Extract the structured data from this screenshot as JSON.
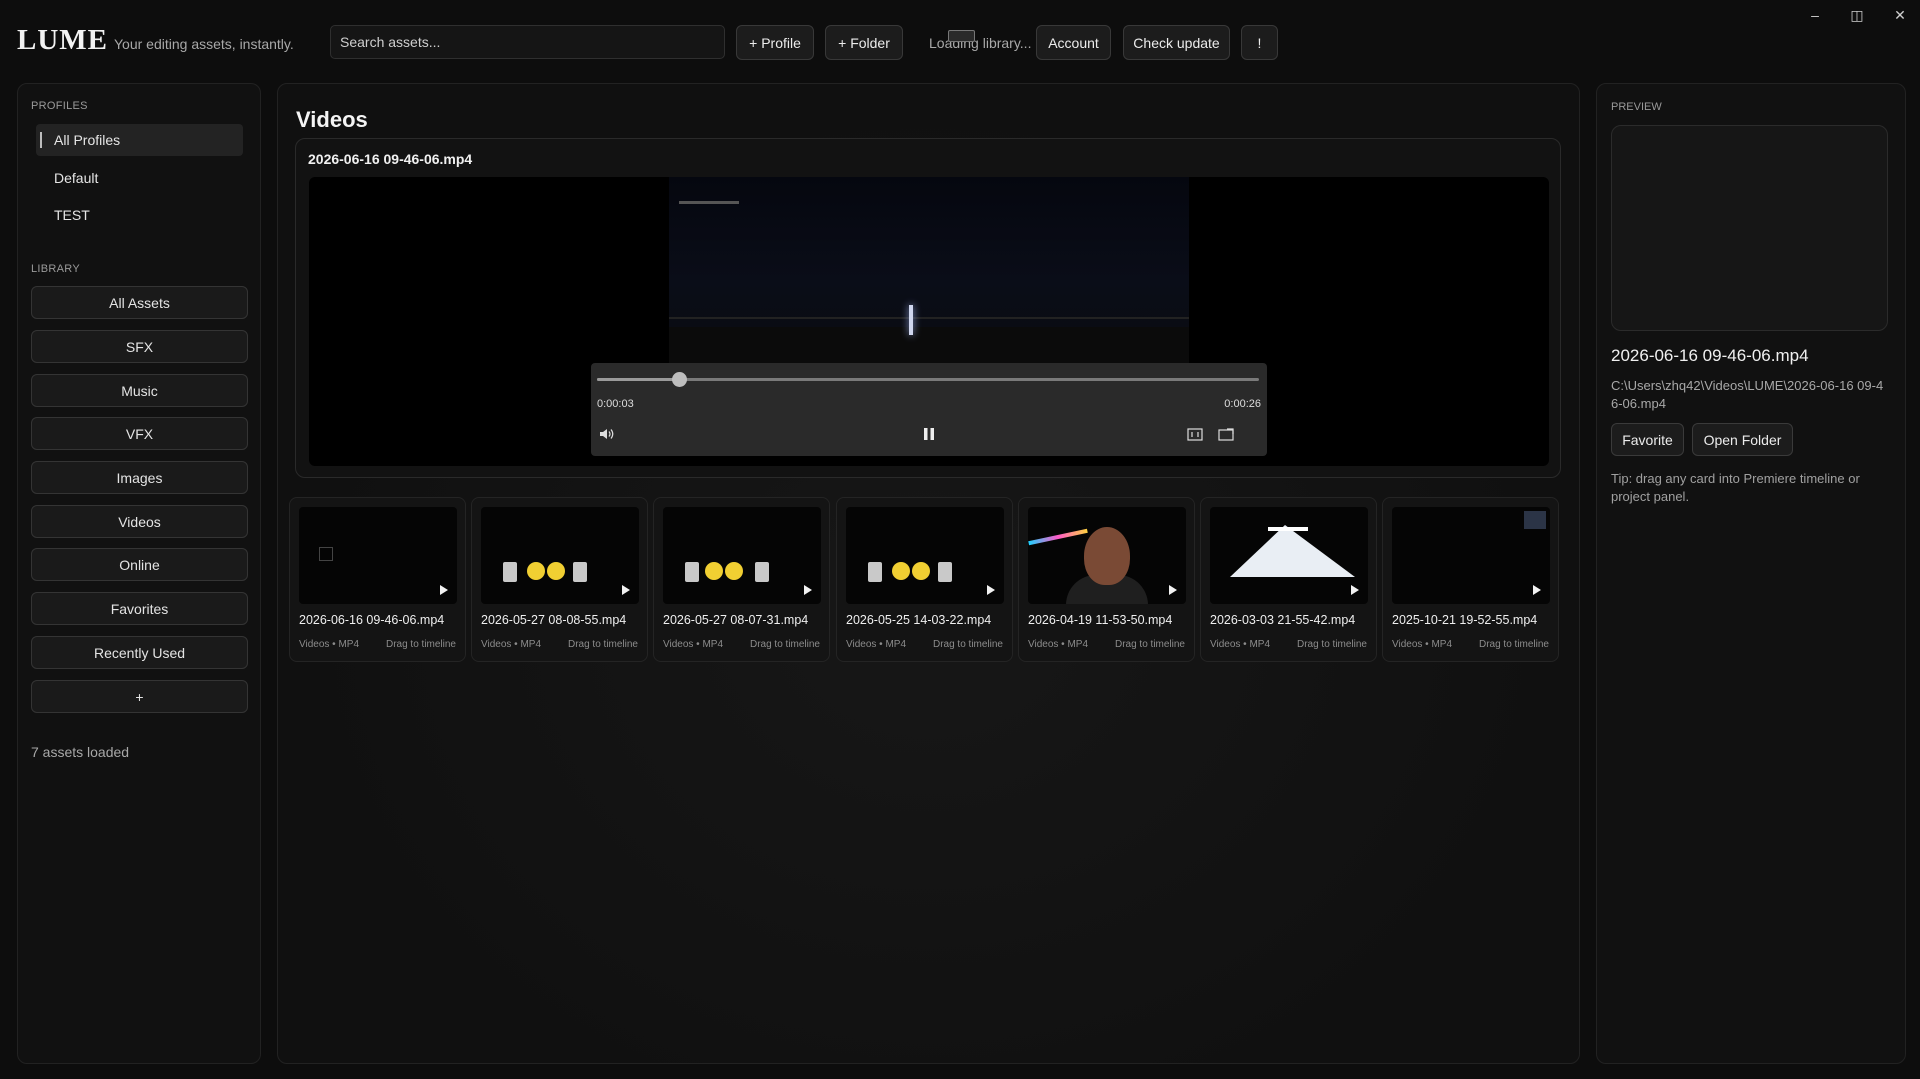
{
  "app": {
    "brand": "LUME",
    "tagline": "Your editing assets, instantly."
  },
  "toolbar": {
    "search_placeholder": "Search assets...",
    "add_profile_label": "+ Profile",
    "add_folder_label": "+ Folder",
    "loading_text": "Loading library...",
    "account_label": "Account",
    "check_update_label": "Check update",
    "alert_label": "!"
  },
  "window_controls": {
    "minimize": "–",
    "maximize": "◫",
    "close": "✕"
  },
  "sidebar": {
    "profiles_heading": "PROFILES",
    "profiles": [
      "All Profiles",
      "Default",
      "TEST"
    ],
    "library_heading": "LIBRARY",
    "library_items": [
      "All Assets",
      "SFX",
      "Music",
      "VFX",
      "Images",
      "Videos",
      "Online",
      "Favorites",
      "Recently Used",
      "+"
    ],
    "assets_count": "7 assets loaded"
  },
  "main": {
    "title": "Videos",
    "player": {
      "file_name": "2026-06-16 09-46-06.mp4",
      "current_time": "0:00:03",
      "duration": "0:00:26",
      "progress": 0.124
    },
    "cards": [
      {
        "name": "2026-06-16 09-46-06.mp4",
        "meta": "Videos • MP4",
        "drag": "Drag to timeline",
        "thumb": "dark"
      },
      {
        "name": "2026-05-27 08-08-55.mp4",
        "meta": "Videos • MP4",
        "drag": "Drag to timeline",
        "thumb": "ui"
      },
      {
        "name": "2026-05-27 08-07-31.mp4",
        "meta": "Videos • MP4",
        "drag": "Drag to timeline",
        "thumb": "ui"
      },
      {
        "name": "2026-05-25 14-03-22.mp4",
        "meta": "Videos • MP4",
        "drag": "Drag to timeline",
        "thumb": "ui"
      },
      {
        "name": "2026-04-19 11-53-50.mp4",
        "meta": "Videos • MP4",
        "drag": "Drag to timeline",
        "thumb": "person"
      },
      {
        "name": "2026-03-03 21-55-42.mp4",
        "meta": "Videos • MP4",
        "drag": "Drag to timeline",
        "thumb": "mountain"
      },
      {
        "name": "2025-10-21 19-52-55.mp4",
        "meta": "Videos • MP4",
        "drag": "Drag to timeline",
        "thumb": "dark"
      }
    ]
  },
  "preview": {
    "heading": "PREVIEW",
    "file_name": "2026-06-16 09-46-06.mp4",
    "path": "C:\\Users\\zhq42\\Videos\\LUME\\2026-06-16 09-46-06.mp4",
    "favorite_label": "Favorite",
    "open_folder_label": "Open Folder",
    "tip": "Tip: drag any card into Premiere timeline or project panel."
  }
}
